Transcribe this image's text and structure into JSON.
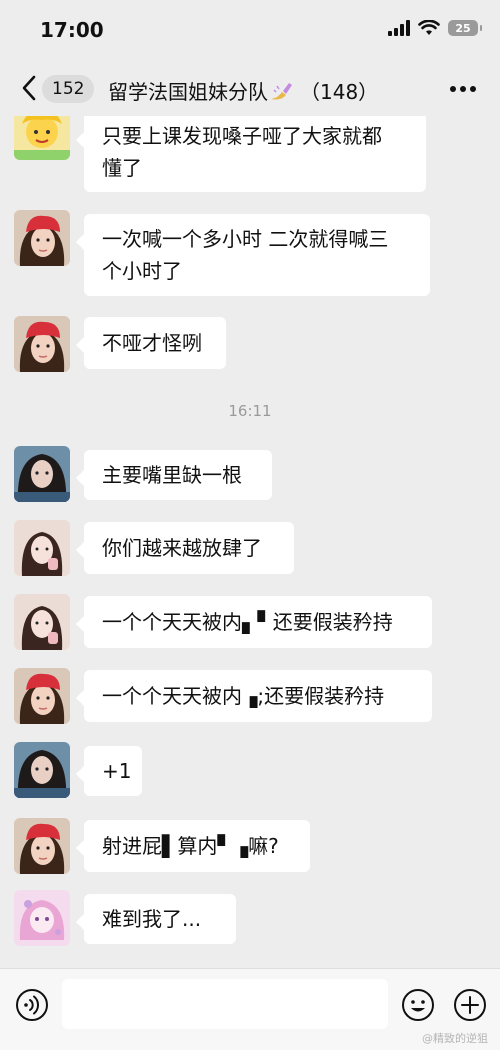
{
  "status_bar": {
    "time": "17:00",
    "battery": "25"
  },
  "header": {
    "back_count": "152",
    "title": "留学法国姐妹分队",
    "member_count": "（148）"
  },
  "messages": [
    {
      "text": "只要上课发现嗓子哑了大家就都\n懂了",
      "avatar": "cartoon-avatar"
    },
    {
      "text": "一次喊一个多小时 二次就得喊三\n个小时了",
      "avatar": "red-cap-avatar"
    },
    {
      "text": "不哑才怪咧",
      "avatar": "red-cap-avatar"
    },
    {
      "text": "主要嘴里缺一根",
      "avatar": "dark-hair-avatar"
    },
    {
      "text": "你们越来越放肆了",
      "avatar": "pale-avatar"
    },
    {
      "text": "一个个天天被内▖▘还要假装矜持",
      "avatar": "pale-avatar"
    },
    {
      "text": "一个个天天被内▗;还要假装矜持",
      "avatar": "red-cap-avatar"
    },
    {
      "text": "+1",
      "avatar": "dark-hair-avatar"
    },
    {
      "text": "射进屁▌算内▘▗嘛?",
      "avatar": "red-cap-avatar"
    },
    {
      "text": "难到我了...",
      "avatar": "pink-cartoon-avatar"
    }
  ],
  "time_divider": "16:11",
  "watermark": "@精致的逆狙",
  "colors": {
    "background": "#ededed",
    "bubble": "#ffffff",
    "input_bar": "#f7f7f7"
  }
}
